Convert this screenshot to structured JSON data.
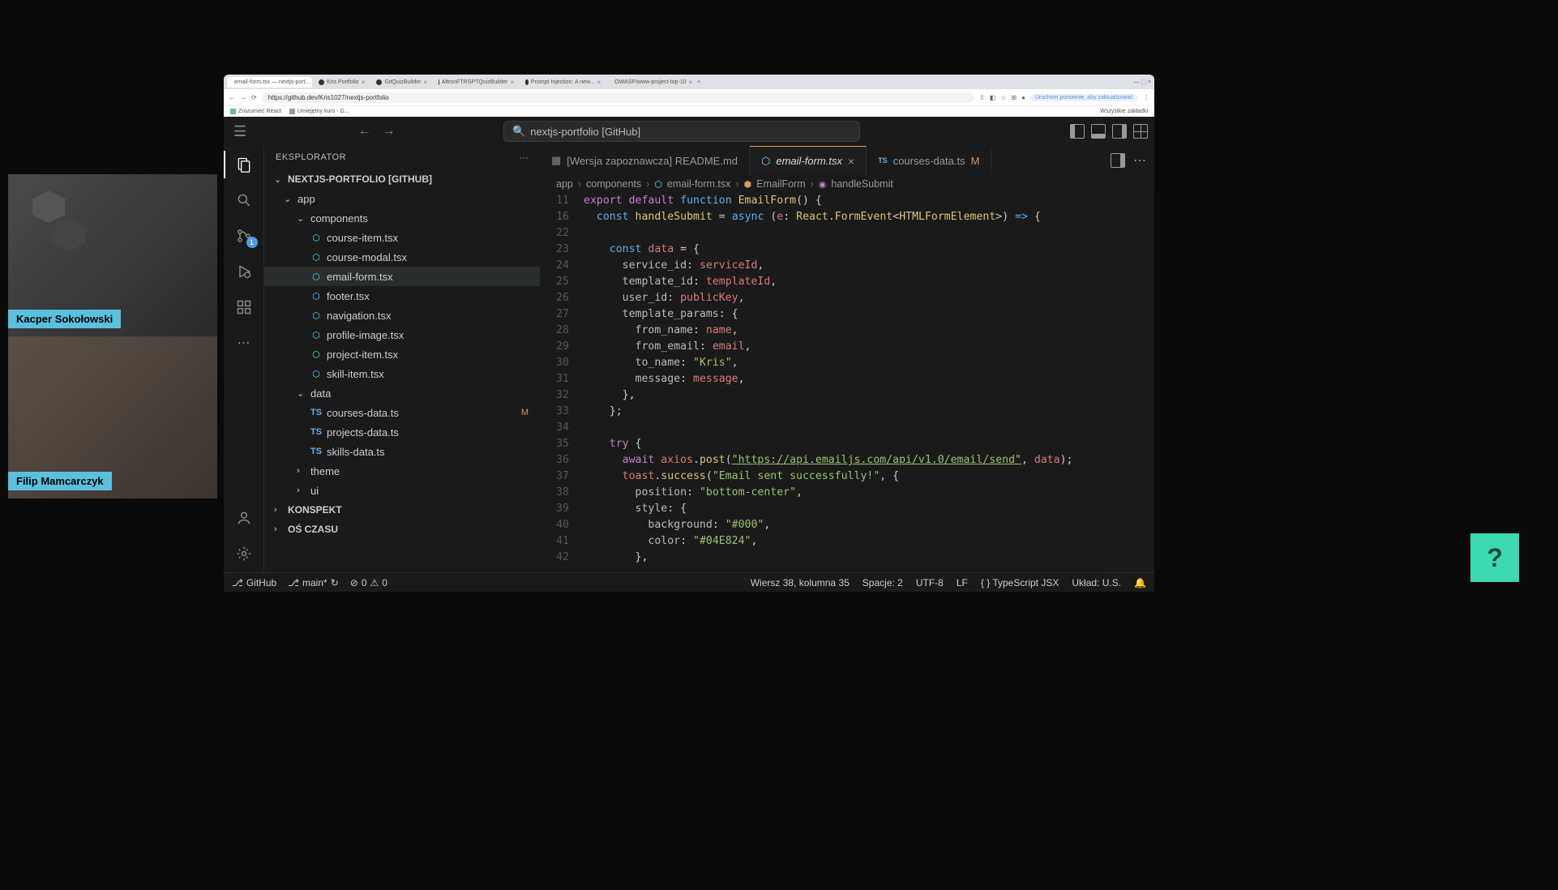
{
  "webcams": [
    {
      "name": "Kacper Sokołowski"
    },
    {
      "name": "Filip Mamcarczyk"
    }
  ],
  "browser": {
    "tabs": [
      {
        "label": "email-form.tsx — nextjs-port...",
        "active": true
      },
      {
        "label": "Kris Portfolio"
      },
      {
        "label": "GitQuizBuilder"
      },
      {
        "label": "AltronFTRSPTQuizBuilder"
      },
      {
        "label": "Prompt Injection: A new..."
      },
      {
        "label": "OWASP/www-project-top-10"
      }
    ],
    "url": "https://github.dev/Kris1027/nextjs-portfolio",
    "bookmarks": [
      "Zrozumieć React",
      "Umiejętny kurs - G..."
    ],
    "bookmarks_right": "Wszystkie zakładki",
    "update_label": "Uruchom ponownie, aby zaktualizować"
  },
  "vscode": {
    "search_placeholder": "nextjs-portfolio [GitHub]",
    "explorer_title": "EKSPLORATOR",
    "project_name": "NEXTJS-PORTFOLIO [GITHUB]",
    "source_control_badge": "1",
    "tree": {
      "app": {
        "label": "app",
        "components": {
          "label": "components",
          "files": [
            "course-item.tsx",
            "course-modal.tsx",
            "email-form.tsx",
            "footer.tsx",
            "navigation.tsx",
            "profile-image.tsx",
            "project-item.tsx",
            "skill-item.tsx"
          ]
        },
        "data": {
          "label": "data",
          "files": [
            {
              "name": "courses-data.ts",
              "mod": "M"
            },
            {
              "name": "projects-data.ts"
            },
            {
              "name": "skills-data.ts"
            }
          ]
        },
        "theme": "theme",
        "ui": "ui"
      },
      "konspekt": "KONSPEKT",
      "os_czasu": "OŚ CZASU"
    },
    "editor_tabs": [
      {
        "icon": "preview",
        "name": "[Wersja zapoznawcza] README.md",
        "active": false
      },
      {
        "icon": "react",
        "name": "email-form.tsx",
        "active": true,
        "close": true
      },
      {
        "icon": "ts",
        "name": "courses-data.ts",
        "active": false,
        "mod": "M"
      }
    ],
    "breadcrumb": [
      "app",
      "components",
      "email-form.tsx",
      "EmailForm",
      "handleSubmit"
    ],
    "code": {
      "lines": [
        {
          "n": 11,
          "html": "<span class='tk-kw'>export</span> <span class='tk-kw'>default</span> <span class='tk-kw2'>function</span> <span class='tk-fn'>EmailForm</span>() {"
        },
        {
          "n": 16,
          "html": "  <span class='tk-kw2'>const</span> <span class='tk-fn'>handleSubmit</span> <span class='tk-op'>=</span> <span class='tk-kw2'>async</span> (<span class='tk-var'>e</span>: <span class='tk-fn'>React</span>.<span class='tk-fn'>FormEvent</span>&lt;<span class='tk-fn'>HTMLFormElement</span>&gt;) <span class='tk-kw2'>=&gt;</span> {"
        },
        {
          "n": 22,
          "html": ""
        },
        {
          "n": 23,
          "html": "    <span class='tk-kw2'>const</span> <span class='tk-var'>data</span> <span class='tk-op'>=</span> {"
        },
        {
          "n": 24,
          "html": "      <span class='tk-prop'>service_id</span>: <span class='tk-var'>serviceId</span>,"
        },
        {
          "n": 25,
          "html": "      <span class='tk-prop'>template_id</span>: <span class='tk-var'>templateId</span>,"
        },
        {
          "n": 26,
          "html": "      <span class='tk-prop'>user_id</span>: <span class='tk-var'>publicKey</span>,"
        },
        {
          "n": 27,
          "html": "      <span class='tk-prop'>template_params</span>: {"
        },
        {
          "n": 28,
          "html": "        <span class='tk-prop'>from_name</span>: <span class='tk-var'>name</span>,"
        },
        {
          "n": 29,
          "html": "        <span class='tk-prop'>from_email</span>: <span class='tk-var'>email</span>,"
        },
        {
          "n": 30,
          "html": "        <span class='tk-prop'>to_name</span>: <span class='tk-str'>\"Kris\"</span>,"
        },
        {
          "n": 31,
          "html": "        <span class='tk-prop'>message</span>: <span class='tk-var'>message</span>,"
        },
        {
          "n": 32,
          "html": "      },"
        },
        {
          "n": 33,
          "html": "    };"
        },
        {
          "n": 34,
          "html": ""
        },
        {
          "n": 35,
          "html": "    <span class='tk-kw'>try</span> {"
        },
        {
          "n": 36,
          "html": "      <span class='tk-kw'>await</span> <span class='tk-var'>axios</span>.<span class='tk-fn'>post</span>(<span class='tk-url'>\"https://api.emailjs.com/api/v1.0/email/send\"</span>, <span class='tk-var'>data</span>);"
        },
        {
          "n": 37,
          "html": "      <span class='tk-var'>toast</span>.<span class='tk-fn'>success</span>(<span class='tk-str'>\"Email sent successfully!\"</span>, {"
        },
        {
          "n": 38,
          "html": "        <span class='tk-prop'>position</span>: <span class='tk-str'>\"bottom-center\"</span>,"
        },
        {
          "n": 39,
          "html": "        <span class='tk-prop'>style</span>: {"
        },
        {
          "n": 40,
          "html": "          <span class='tk-prop'>background</span>: <span class='tk-str'>\"#000\"</span>,"
        },
        {
          "n": 41,
          "html": "          <span class='tk-prop'>color</span>: <span class='tk-str'>\"#04E824\"</span>,"
        },
        {
          "n": 42,
          "html": "        },"
        }
      ]
    },
    "status": {
      "remote": "GitHub",
      "branch": "main*",
      "sync": "↻",
      "errors": "0",
      "warnings": "0",
      "cursor": "Wiersz 38, kolumna 35",
      "spaces": "Spacje: 2",
      "encoding": "UTF-8",
      "eol": "LF",
      "lang": "TypeScript JSX",
      "layout": "Układ: U.S."
    }
  }
}
